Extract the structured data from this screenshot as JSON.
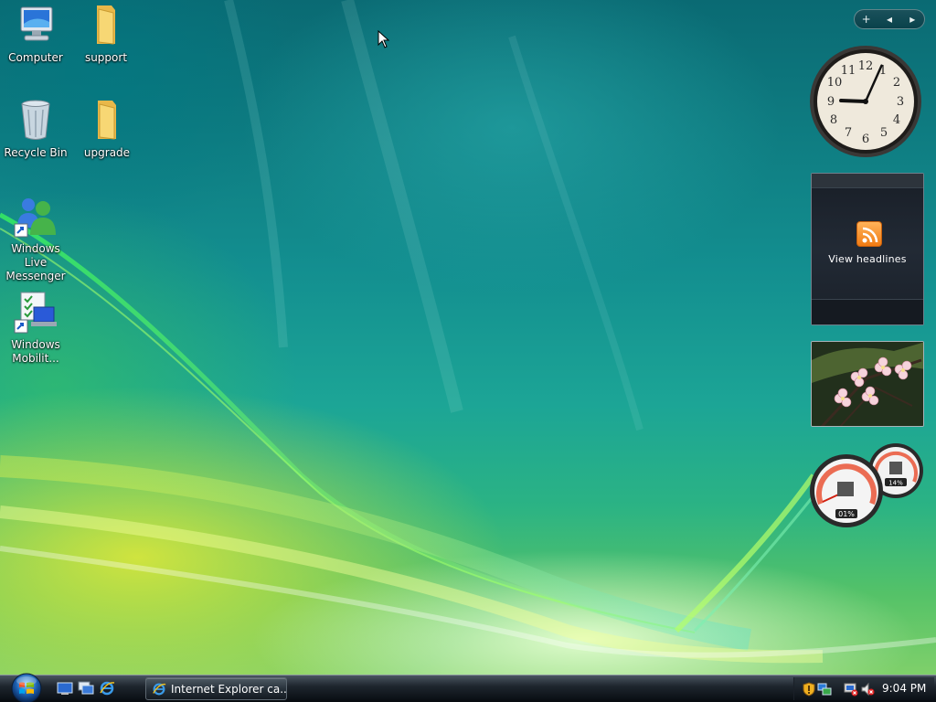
{
  "desktop": {
    "icons": [
      {
        "label": "Computer",
        "icon": "computer-icon"
      },
      {
        "label": "support",
        "icon": "folder-icon"
      },
      {
        "label": "Recycle Bin",
        "icon": "recycle-bin-icon"
      },
      {
        "label": "upgrade",
        "icon": "folder-icon"
      },
      {
        "label": "Windows Live Messenger ...",
        "icon": "messenger-icon"
      },
      {
        "label": "Windows Mobilit...",
        "icon": "mobility-center-icon"
      }
    ]
  },
  "sidebar": {
    "controls": {
      "add": "+",
      "prev": "◂",
      "next": "▸"
    },
    "clock": {
      "hour": 9,
      "minute": 4
    },
    "feed": {
      "label": "View headlines",
      "icon": "rss-icon"
    },
    "slideshow": {
      "icon": "slideshow-image"
    },
    "meters": {
      "cpu": "01%",
      "memory": "14%"
    }
  },
  "taskbar": {
    "quick_launch": [
      "show-desktop-icon",
      "switch-windows-icon",
      "internet-explorer-icon"
    ],
    "tasks": [
      {
        "label": "Internet Explorer ca...",
        "icon": "internet-explorer-icon"
      }
    ],
    "tray": {
      "icons": [
        "security-shield-icon",
        "network-icon",
        "display-icon",
        "volume-muted-icon"
      ],
      "time": "9:04 PM"
    }
  },
  "colors": {
    "accent": "#1ea79a",
    "taskbar": "#1e262e",
    "rss": "#f07b13"
  }
}
